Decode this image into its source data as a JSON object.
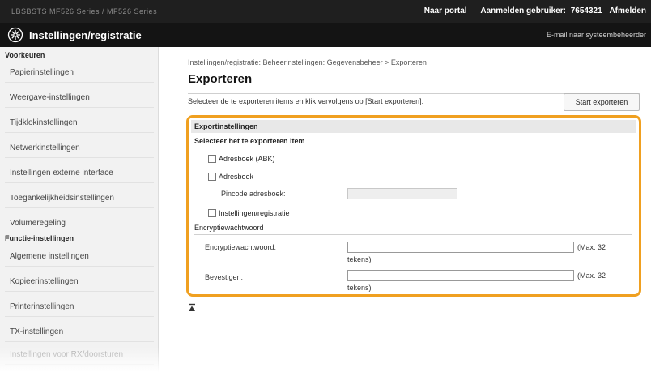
{
  "topbar": {
    "device_name": "LBSBSTS  MF526 Series / MF526 Series",
    "portal_link": "Naar portal",
    "user_label": "Aanmelden gebruiker:",
    "user_id": "7654321",
    "logout_link": "Afmelden"
  },
  "header": {
    "title": "Instellingen/registratie",
    "mail_link": "E-mail naar systeembeheerder"
  },
  "sidebar": {
    "sections": [
      {
        "title": "Voorkeuren",
        "items": [
          "Papierinstellingen",
          "Weergave-instellingen",
          "Tijdklokinstellingen",
          "Netwerkinstellingen",
          "Instellingen externe interface",
          "Toegankelijkheidsinstellingen",
          "Volumeregeling"
        ]
      },
      {
        "title": "Functie-instellingen",
        "items": [
          "Algemene instellingen",
          "Kopieerinstellingen",
          "Printerinstellingen",
          "TX-instellingen",
          "Instellingen voor RX/doorsturen"
        ]
      }
    ]
  },
  "main": {
    "breadcrumb": "Instellingen/registratie: Beheerinstellingen: Gegevensbeheer > Exporteren",
    "title": "Exporteren",
    "instruction": "Selecteer de te exporteren items en klik vervolgens op [Start exporteren].",
    "start_button": "Start exporteren",
    "panel": {
      "heading": "Exportinstellingen",
      "select_heading": "Selecteer het te exporteren item",
      "items": [
        {
          "label": "Adresboek (ABK)",
          "checked": false
        },
        {
          "label": "Adresboek",
          "checked": false
        },
        {
          "label": "Instellingen/registratie",
          "checked": false
        }
      ],
      "pincode_label": "Pincode adresboek:",
      "pincode_value": "",
      "encryption_heading": "Encryptiewachtwoord",
      "encryption_label": "Encryptiewachtwoord:",
      "encryption_value": "",
      "confirm_label": "Bevestigen:",
      "confirm_value": "",
      "max_note": "(Max. 32",
      "max_note_wrap": "tekens)"
    }
  },
  "colors": {
    "accent_border": "#f0a020",
    "topbar_bg": "#1f1f1f",
    "titlebar_bg": "#141414",
    "sidebar_bg": "#f2f2f2"
  }
}
